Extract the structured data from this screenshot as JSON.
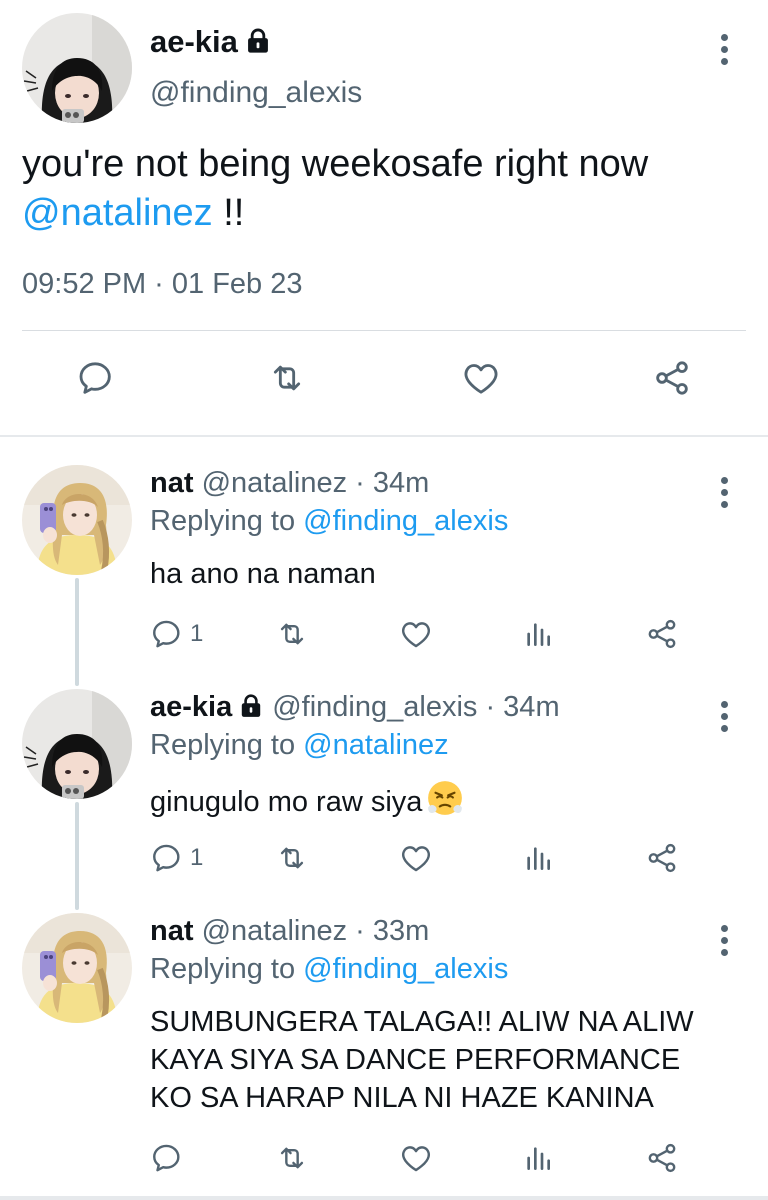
{
  "main_tweet": {
    "name": "ae-kia",
    "handle": "@finding_alexis",
    "text_before": "you're not being weekosafe right now ",
    "mention": "@natalinez",
    "text_after": " !!",
    "timestamp": "09:52 PM · 01 Feb 23"
  },
  "replies": [
    {
      "name": "nat",
      "handle": "@natalinez",
      "time": "· 34m",
      "replying_label": "Replying to",
      "replying_to": "@finding_alexis",
      "lines": [
        "ha ano na naman"
      ],
      "reply_count": "1",
      "emoji": ""
    },
    {
      "name": "ae-kia",
      "handle": "@finding_alexis",
      "time": "· 34m",
      "replying_label": "Replying to",
      "replying_to": "@natalinez",
      "lines": [
        "ginugulo mo raw siya"
      ],
      "reply_count": "1",
      "emoji": "face-with-steam-from-nose"
    },
    {
      "name": "nat",
      "handle": "@natalinez",
      "time": "· 33m",
      "replying_label": "Replying to",
      "replying_to": "@finding_alexis",
      "lines": [
        "SUMBUNGERA TALAGA!! ALIW NA ALIW",
        "KAYA SIYA SA DANCE PERFORMANCE",
        "KO SA HARAP NILA NI HAZE KANINA"
      ],
      "reply_count": "",
      "emoji": ""
    }
  ],
  "icons": [
    "lock-icon",
    "more-icon",
    "reply-icon",
    "retweet-icon",
    "like-icon",
    "share-icon",
    "analytics-icon"
  ],
  "colors": {
    "text": "#0f1419",
    "secondary": "#536471",
    "link": "#1d9bf0",
    "thread_line": "#cfd9de"
  }
}
